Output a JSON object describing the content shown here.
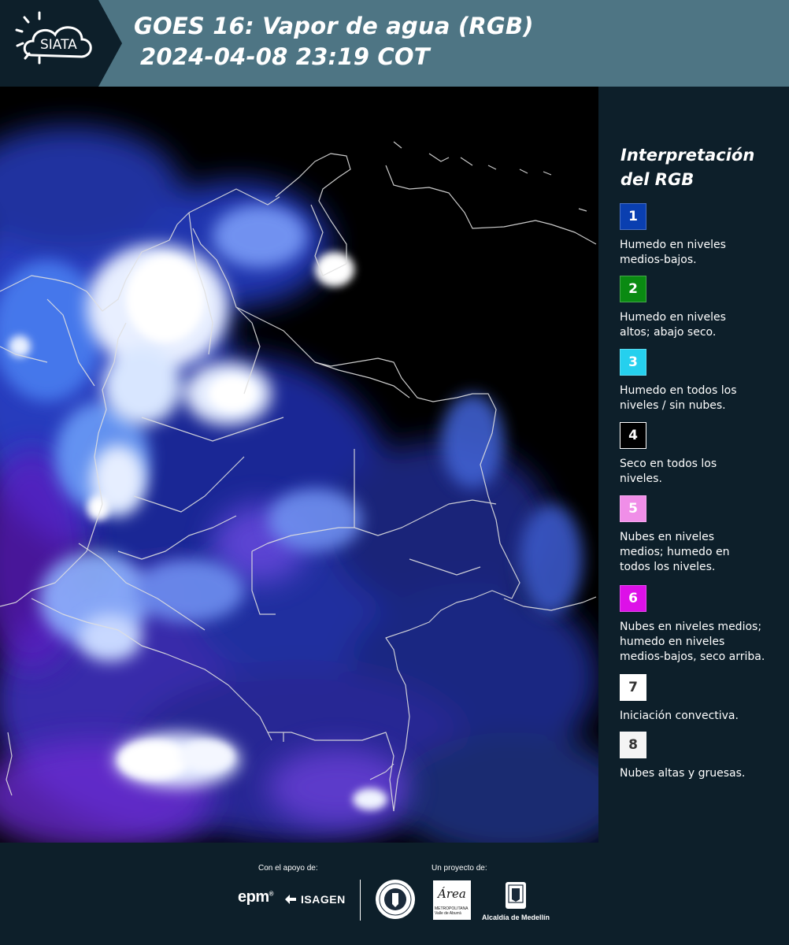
{
  "header": {
    "logo_text": "SIATA",
    "title_line1": "GOES 16: Vapor de agua (RGB)",
    "title_line2": "2024-04-08 23:19 COT",
    "background": "#4e7584",
    "logo_background": "#0d1f2a"
  },
  "legend": {
    "title": "Interpretación del RGB",
    "items": [
      {
        "number": "1",
        "text": "Humedo en niveles\nmedios-bajos.",
        "color": "#0a3fb0",
        "number_color": "#ffffff"
      },
      {
        "number": "2",
        "text": "Humedo en niveles\naltos; abajo seco.",
        "color": "#0a8a12",
        "number_color": "#ffffff"
      },
      {
        "number": "3",
        "text": "Humedo en todos los\nniveles / sin nubes.",
        "color": "#25d0ee",
        "number_color": "#ffffff"
      },
      {
        "number": "4",
        "text": "Seco en todos los\nniveles.",
        "color": "#000000",
        "number_color": "#ffffff"
      },
      {
        "number": "5",
        "text": "Nubes en niveles\nmedios; humedo en\ntodos los niveles.",
        "color": "#f08ee8",
        "number_color": "#ffffff"
      },
      {
        "number": "6",
        "text": "Nubes en niveles medios;\nhumedo en niveles\nmedios-bajos, seco arriba.",
        "color": "#dd10e8",
        "number_color": "#ffffff"
      },
      {
        "number": "7",
        "text": "Iniciación convectiva.",
        "color": "#ffffff",
        "number_color": "#333333"
      },
      {
        "number": "8",
        "text": "Nubes altas y gruesas.",
        "color": "#f4f4f4",
        "number_color": "#333333"
      }
    ]
  },
  "footer": {
    "support_label": "Con el apoyo de:",
    "project_label": "Un proyecto de:",
    "partner_epm": "epm",
    "partner_isagen": "ISAGEN",
    "partner_metro": "METROPOLITANA\nValle de Aburrá",
    "partner_metro_script": "Área",
    "partner_alcaldia": "Alcaldía de Medellín"
  }
}
